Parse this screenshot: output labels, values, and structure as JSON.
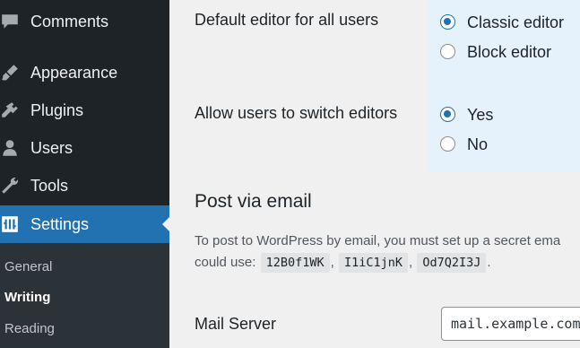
{
  "sidebar": {
    "items": [
      {
        "label": "Comments",
        "icon": "comments-icon"
      },
      {
        "label": "Appearance",
        "icon": "appearance-icon"
      },
      {
        "label": "Plugins",
        "icon": "plugins-icon"
      },
      {
        "label": "Users",
        "icon": "users-icon"
      },
      {
        "label": "Tools",
        "icon": "tools-icon"
      },
      {
        "label": "Settings",
        "icon": "settings-icon"
      }
    ],
    "submenu": [
      "General",
      "Writing",
      "Reading"
    ]
  },
  "editor": {
    "default_label": "Default editor for all users",
    "classic_label": "Classic editor",
    "block_label": "Block editor",
    "switch_label": "Allow users to switch editors",
    "yes_label": "Yes",
    "no_label": "No"
  },
  "post_via_email": {
    "title": "Post via email",
    "desc_line1": "To post to WordPress by email, you must set up a secret ema",
    "desc_line2_start": "could use:",
    "codes": [
      "12B0f1WK",
      "I1iC1jnK",
      "Od7Q2I3J"
    ],
    "sep": ",",
    "end": ".",
    "mail_server_label": "Mail Server",
    "mail_server_value": "mail.example.com"
  },
  "colors": {
    "accent": "#2271b1",
    "sidebar": "#1d2327",
    "panel": "#e5f1fb"
  }
}
